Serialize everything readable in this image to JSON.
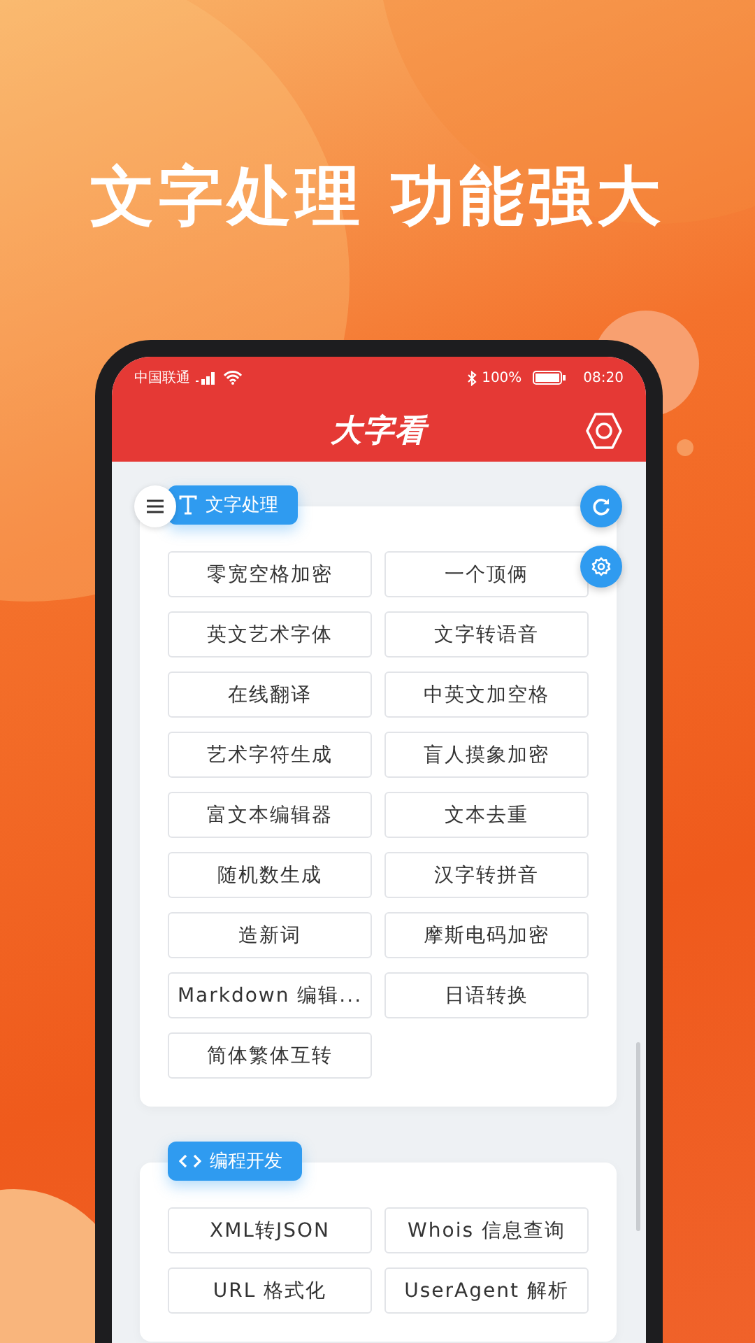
{
  "headline": "文字处理 功能强大",
  "status_bar": {
    "carrier": "中国联通",
    "battery": "100%",
    "time": "08:20"
  },
  "app_bar": {
    "title": "大字看"
  },
  "sections": [
    {
      "kind": "text",
      "title": "文字处理",
      "tools": [
        "零宽空格加密",
        "一个顶俩",
        "英文艺术字体",
        "文字转语音",
        "在线翻译",
        "中英文加空格",
        "艺术字符生成",
        "盲人摸象加密",
        "富文本编辑器",
        "文本去重",
        "随机数生成",
        "汉字转拼音",
        "造新词",
        "摩斯电码加密",
        "Markdown 编辑...",
        "日语转换",
        "简体繁体互转"
      ]
    },
    {
      "kind": "code",
      "title": "编程开发",
      "tools": [
        "XML转JSON",
        "Whois 信息查询",
        "URL 格式化",
        "UserAgent 解析"
      ]
    }
  ]
}
